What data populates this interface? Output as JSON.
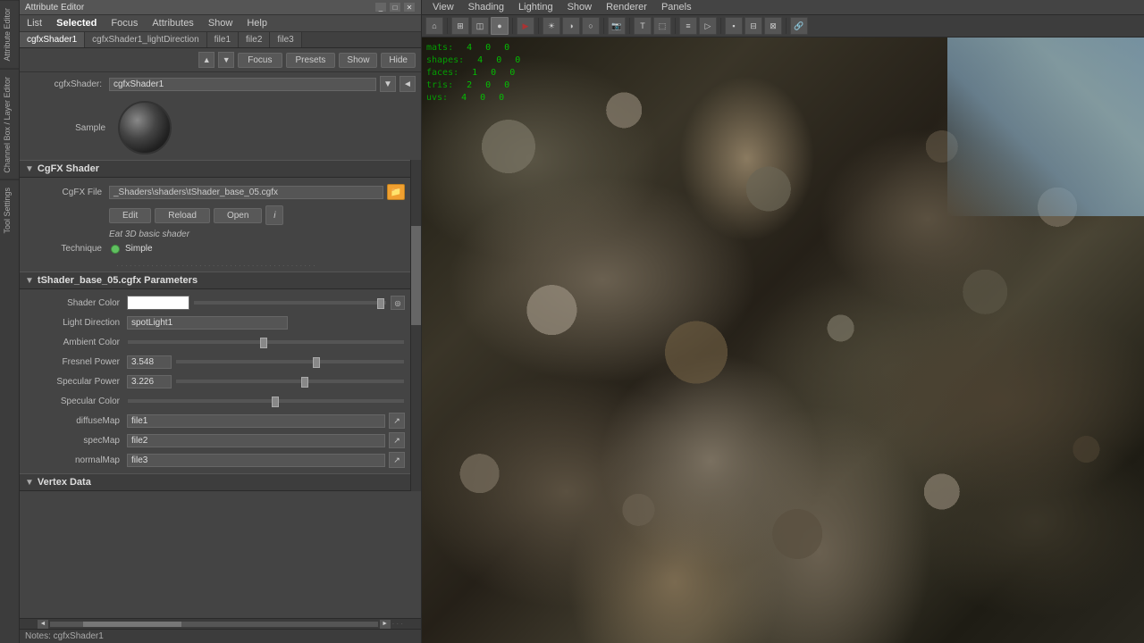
{
  "window": {
    "title": "Attribute Editor"
  },
  "attr_panel": {
    "title": "Attribute Editor",
    "menu_items": [
      "List",
      "Selected",
      "Focus",
      "Attributes",
      "Show",
      "Help"
    ],
    "selected_menu": "Selected",
    "tabs": [
      "cgfxShader1",
      "cgfxShader1_lightDirection",
      "file1",
      "file2",
      "file3"
    ],
    "active_tab": "cgfxShader1",
    "focus_btn": "Focus",
    "presets_btn": "Presets",
    "show_btn": "Show",
    "hide_btn": "Hide",
    "shader_label": "cgfxShader:",
    "shader_value": "cgfxShader1",
    "sample_label": "Sample"
  },
  "cgfx_section": {
    "title": "CgFX Shader",
    "file_label": "CgFX File",
    "file_path": "_Shaders\\shaders\\tShader_base_05.cgfx",
    "edit_btn": "Edit",
    "reload_btn": "Reload",
    "open_btn": "Open",
    "shader_desc": "Eat 3D basic shader",
    "technique_label": "Technique",
    "technique_value": "Simple"
  },
  "params_section": {
    "title": "tShader_base_05.cgfx Parameters",
    "params": [
      {
        "label": "Shader Color",
        "type": "color-white",
        "has_slider": true
      },
      {
        "label": "Light Direction",
        "type": "text",
        "value": "spotLight1"
      },
      {
        "label": "Ambient Color",
        "type": "slider-only",
        "slider_pos": 0.5
      },
      {
        "label": "Fresnel Power",
        "type": "number-slider",
        "value": "3.548",
        "slider_pos": 0.65
      },
      {
        "label": "Specular Power",
        "type": "number-slider",
        "value": "3.226",
        "slider_pos": 0.6
      },
      {
        "label": "Specular Color",
        "type": "slider-only",
        "slider_pos": 0.55
      }
    ],
    "file_params": [
      {
        "label": "diffuseMap",
        "value": "file1"
      },
      {
        "label": "specMap",
        "value": "file2"
      },
      {
        "label": "normalMap",
        "value": "file3"
      }
    ]
  },
  "vertex_section": {
    "title": "Vertex Data"
  },
  "notes": "Notes: cgfxShader1",
  "viewport": {
    "menus": [
      "View",
      "Shading",
      "Lighting",
      "Show",
      "Renderer",
      "Panels"
    ],
    "hud": {
      "rows": [
        {
          "name": "mats:",
          "cols": [
            "4",
            "0",
            "0"
          ]
        },
        {
          "name": "shapes:",
          "cols": [
            "4",
            "0",
            "0"
          ]
        },
        {
          "name": "faces:",
          "cols": [
            "1",
            "0",
            "0"
          ]
        },
        {
          "name": "tris:",
          "cols": [
            "2",
            "0",
            "0"
          ]
        },
        {
          "name": "uvs:",
          "cols": [
            "4",
            "0",
            "0"
          ]
        }
      ]
    }
  },
  "icons": {
    "arrow_down": "▼",
    "arrow_right": "►",
    "close": "✕",
    "arrow_left": "◄",
    "arrow_up": "▲",
    "folder": "📁",
    "info": "i",
    "file_arrow": "↗"
  }
}
